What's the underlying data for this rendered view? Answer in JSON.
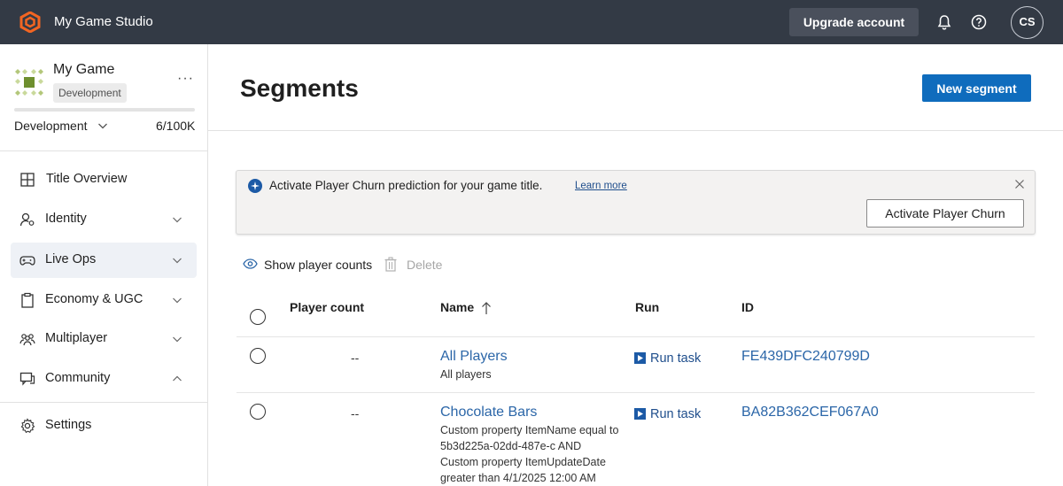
{
  "topbar": {
    "studio_name": "My Game Studio",
    "upgrade_label": "Upgrade account",
    "avatar_initials": "CS",
    "icons": [
      "playfab-logo-icon",
      "bell-icon",
      "help-icon"
    ]
  },
  "sidebar": {
    "game_name": "My Game",
    "environment_badge": "Development",
    "more_label": "···",
    "environment_select": "Development",
    "player_quota": "6/100K",
    "quota_fraction": 6e-05,
    "nav": [
      {
        "label": "Title Overview",
        "icon": "grid-icon",
        "expandable": false
      },
      {
        "label": "Identity",
        "icon": "identity-icon",
        "expandable": true,
        "expanded": false
      },
      {
        "label": "Live Ops",
        "icon": "gamepad-icon",
        "expandable": true,
        "expanded": false,
        "active": true
      },
      {
        "label": "Economy & UGC",
        "icon": "clipboard-icon",
        "expandable": true,
        "expanded": false
      },
      {
        "label": "Multiplayer",
        "icon": "people-icon",
        "expandable": true,
        "expanded": false
      },
      {
        "label": "Community",
        "icon": "chat-icon",
        "expandable": true,
        "expanded": true
      }
    ],
    "settings_label": "Settings"
  },
  "main": {
    "title": "Segments",
    "new_segment_label": "New segment",
    "banner": {
      "text": "Activate Player Churn prediction for your game title.",
      "learn_more": "Learn more",
      "activate_label": "Activate Player Churn"
    },
    "commands": {
      "show_counts": "Show player counts",
      "delete": "Delete"
    },
    "table": {
      "columns": [
        "Player count",
        "Name",
        "Run",
        "ID"
      ],
      "sort_column": "Name",
      "sort_direction": "ascending",
      "rows": [
        {
          "player_count": "--",
          "name": "All Players",
          "description": "All players",
          "run": "Run task",
          "id": "FE439DFC240799D"
        },
        {
          "player_count": "--",
          "name": "Chocolate Bars",
          "description": "Custom property ItemName equal to 5b3d225a-02dd-487e-c AND Custom property ItemUpdateDate greater than 4/1/2025 12:00 AM",
          "run": "Run task",
          "id": "BA82B362CEF067A0"
        }
      ]
    }
  },
  "colors": {
    "topbar_bg": "#333a45",
    "accent": "#0f6cbd",
    "logo": "#f26522",
    "link": "#2b66a8"
  }
}
